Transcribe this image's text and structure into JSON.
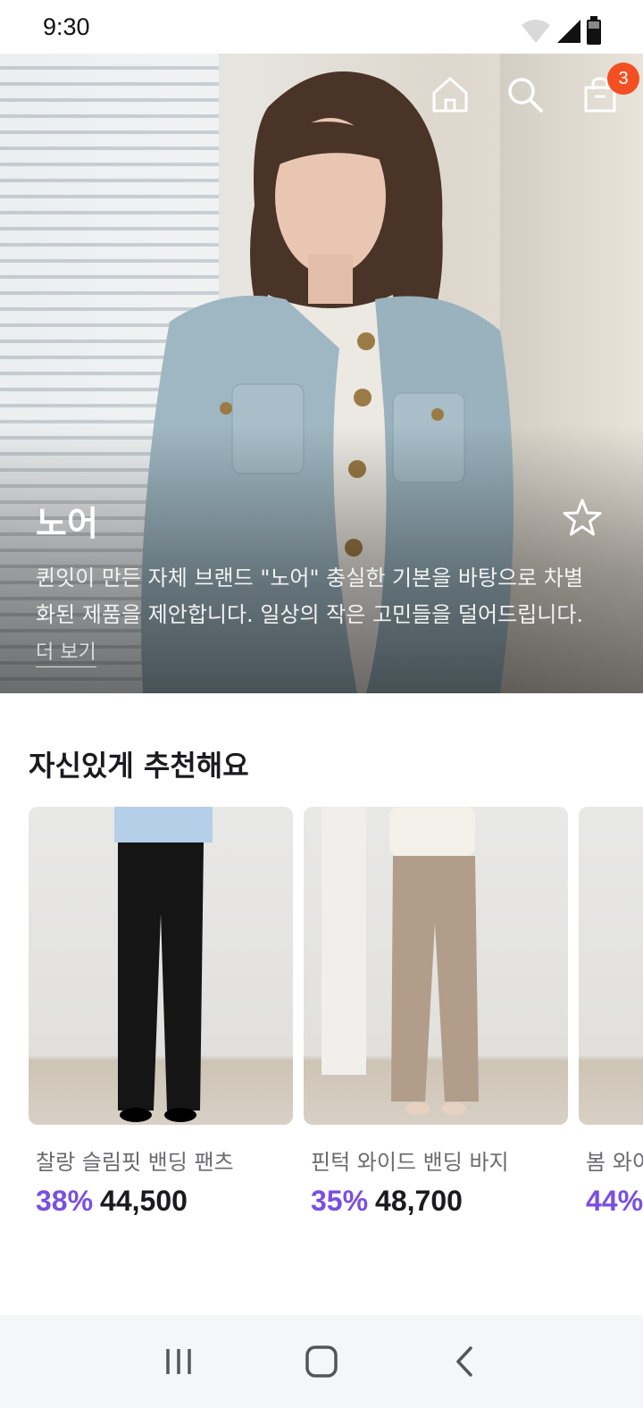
{
  "status_bar": {
    "time": "9:30",
    "icons": [
      "wifi-icon",
      "cellular-signal-icon",
      "battery-icon"
    ]
  },
  "hero": {
    "nav_icons": [
      "home-icon",
      "search-icon",
      "shopping-bag-icon"
    ],
    "cart_count": "3",
    "title": "노어",
    "description": "퀸잇이 만든 자체 브랜드 \"노어\" 충실한 기본을 바탕으로 차별화된 제품을 제안합니다. 일상의 작은 고민들을 덜어드립니다.",
    "more_label": "더 보기",
    "favorite_icon": "star-outline-icon"
  },
  "recommend": {
    "title": "자신있게 추천해요",
    "products": [
      {
        "name": "찰랑 슬림핏 밴딩 팬츠",
        "discount": "38%",
        "price": "44,500"
      },
      {
        "name": "핀턱 와이드 밴딩 바지",
        "discount": "35%",
        "price": "48,700"
      },
      {
        "name": "봄 와이",
        "discount": "44%",
        "price": ""
      }
    ]
  },
  "bottom_nav": {
    "icons": [
      "recent-apps-icon",
      "home-button-icon",
      "back-icon"
    ]
  },
  "colors": {
    "accent_purple": "#7b4fe0",
    "badge_orange": "#f25022",
    "nav_background": "#f5f6f8"
  }
}
